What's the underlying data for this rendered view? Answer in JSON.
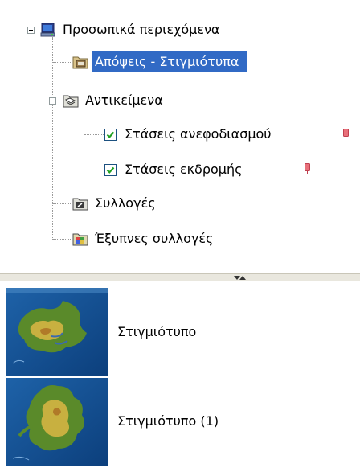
{
  "tree": {
    "root": {
      "label": "Προσωπικά περιεχόμενα",
      "icon": "computer-icon",
      "expanded": true
    },
    "items": [
      {
        "id": "views",
        "label": "Απόψεις - Στιγμιότυπα",
        "icon": "snapshot-folder-icon",
        "selected": true
      },
      {
        "id": "objects",
        "label": "Αντικείμενα",
        "icon": "objects-folder-icon",
        "expanded": true,
        "children": [
          {
            "id": "refuel",
            "label": "Στάσεις ανεφοδιασμού",
            "checked": true,
            "pin_color": "#e8707a"
          },
          {
            "id": "excursion",
            "label": "Στάσεις εκδρομής",
            "checked": true,
            "pin_color": "#e8707a"
          }
        ]
      },
      {
        "id": "collections",
        "label": "Συλλογές",
        "icon": "collections-folder-icon"
      },
      {
        "id": "smart",
        "label": "Έξυπνες συλλογές",
        "icon": "smart-collections-folder-icon"
      }
    ]
  },
  "snapshots": [
    {
      "label": "Στιγμιότυπο",
      "thumbnail": "island-map-thumbnail"
    },
    {
      "label": "Στιγμιότυπο (1)",
      "thumbnail": "island-map-thumbnail"
    }
  ],
  "colors": {
    "selection": "#316ac5",
    "splitter": "#e9e7de",
    "check": "#21a121"
  }
}
